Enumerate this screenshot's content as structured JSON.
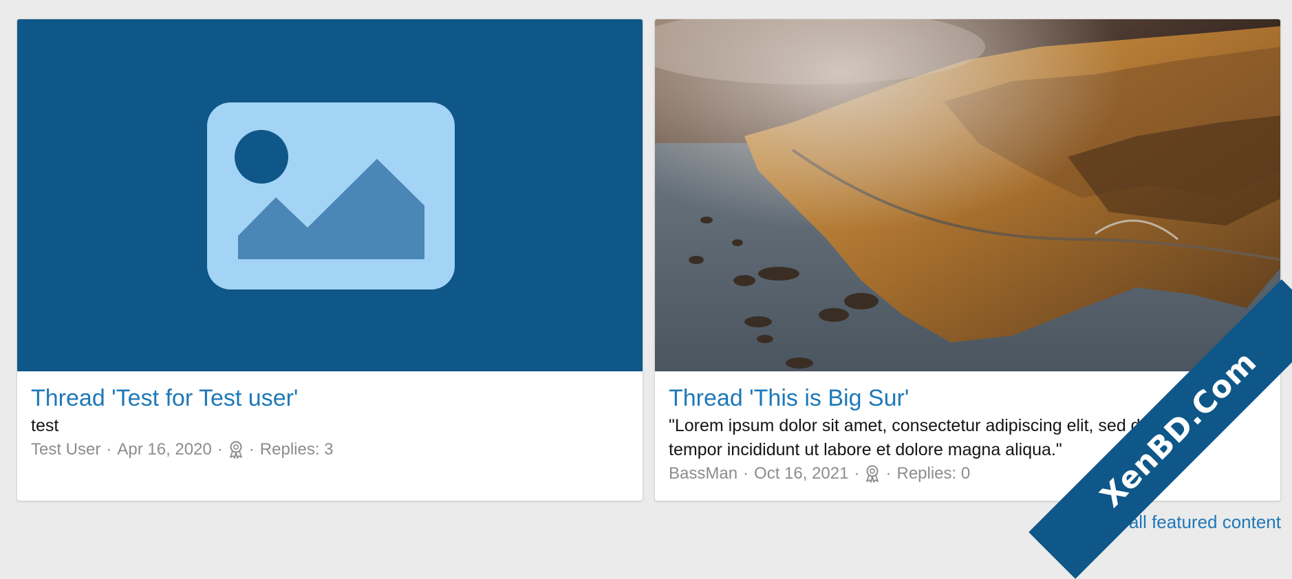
{
  "cards": [
    {
      "title": "Thread 'Test for Test user'",
      "snippet": "test",
      "author": "Test User",
      "date": "Apr 16, 2020",
      "replies": "Replies: 3",
      "thumbnail": "placeholder-image-icon"
    },
    {
      "title": "Thread 'This is Big Sur'",
      "snippet": "\"Lorem ipsum dolor sit amet, consectetur adipiscing elit, sed do eiusmod tempor incididunt ut labore et dolore magna aliqua.\"",
      "author": "BassMan",
      "date": "Oct 16, 2021",
      "replies": "Replies: 0",
      "thumbnail": "landscape-photo"
    }
  ],
  "footer": {
    "view_all_label": "View all featured content"
  },
  "watermark": {
    "text": "XenBD.Com"
  },
  "colors": {
    "accent": "#1e78b8",
    "placeholder_bg": "#0f5788",
    "placeholder_fg": "#a3d3f5",
    "background": "#ebebeb"
  }
}
